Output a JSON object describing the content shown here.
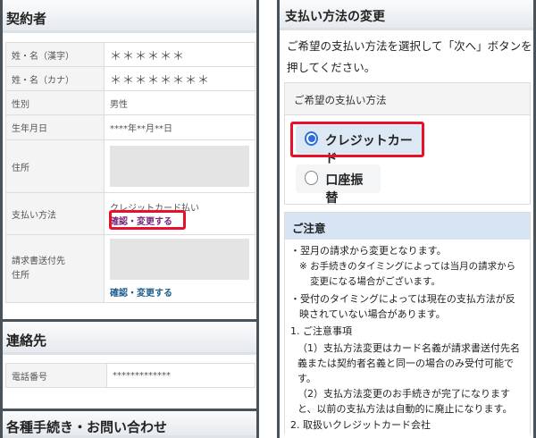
{
  "left": {
    "title": "契約者",
    "rows": [
      {
        "label": "姓・名（漢字）",
        "value": "＊＊＊＊＊＊"
      },
      {
        "label": "姓・名（カナ）",
        "value": "＊＊＊＊＊＊＊＊"
      },
      {
        "label": "性別",
        "value": "男性"
      },
      {
        "label": "生年月日",
        "value": "****年**月**日"
      },
      {
        "label": "住所"
      },
      {
        "label": "支払い方法",
        "value": "クレジットカード払い",
        "link": "確認・変更する"
      },
      {
        "label": "請求書送付先\n住所",
        "link": "確認・変更する"
      }
    ],
    "contact": {
      "title": "連絡先",
      "rows": [
        {
          "label": "電話番号",
          "value": "*************"
        }
      ]
    },
    "procedures": {
      "title": "各種手続き・お問い合わせ"
    }
  },
  "right": {
    "title": "支払い方法の変更",
    "intro": "ご希望の支払い方法を選択して「次へ」ボタンを押してください。",
    "box_title": "ご希望の支払い方法",
    "options": [
      {
        "label": "クレジットカード",
        "selected": true
      },
      {
        "label": "口座振替",
        "selected": false
      }
    ],
    "accent": "#2a6fdb",
    "note": {
      "title": "ご注意",
      "lines": [
        "・翌月の請求から変更となります。",
        "※ お手続きのタイミングによっては当月の請求から変更になる場合がございます。",
        "・受付のタイミングによっては現在の支払方法が反映されていない場合があります。",
        "1. ご注意事項",
        "（1）支払方法変更はカード名義が請求書送付先名義または契約者名義と同一の場合のみ受付可能です。",
        "（2）支払方法変更のお手続きが完了になりますと、以前の支払方法は自動的に廃止になります。",
        "2. 取扱いクレジットカード会社"
      ]
    }
  }
}
